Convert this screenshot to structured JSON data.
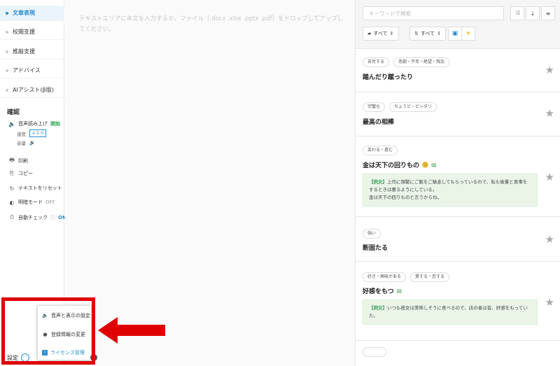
{
  "sidebar": {
    "items": [
      {
        "label": "文章表現",
        "active": true
      },
      {
        "label": "校閲支援"
      },
      {
        "label": "推敲支援"
      },
      {
        "label": "アドバイス"
      },
      {
        "label": "AIアシスト(β版)"
      }
    ],
    "confirm_title": "確認",
    "tts_label": "音声読み上げ",
    "tts_start": "開始",
    "speed_label": "速度",
    "speed_value": "x 1.0",
    "volume_label": "音量",
    "print_label": "印刷",
    "copy_label": "コピー",
    "reset_label": "テキストをリセット",
    "light_mode_label": "明暗モード",
    "light_mode_value": "OFF",
    "auto_check_label": "自動チェック",
    "auto_check_value": "ON",
    "settings_label": "設定"
  },
  "editor": {
    "placeholder": "テキストエリアに本文を入力するか、ファイル（.docx .xlsx .pptx .pdf）をドロップしてアップしてください。"
  },
  "right": {
    "search_placeholder": "キーワードで検索",
    "filter1": "すべて",
    "filter2": "すべて",
    "cards": [
      {
        "tags": [
          "苦労する",
          "悲劇・不幸・絶望・残念"
        ],
        "word": "踏んだり蹴ったり"
      },
      {
        "tags": [
          "完璧な",
          "ちょうど・ピッタリ"
        ],
        "word": "最高の相棒"
      },
      {
        "tags": [
          "変わる・進む"
        ],
        "word": "金は天下の回りもの",
        "example_label": "【例文】",
        "example": "上司に頻繁にご飯をご馳走してもらっているので、私も後輩と食事をするときは奢るようにしている。",
        "example2": "金は天下の回りものと言うからね。"
      },
      {
        "tags": [
          "強い"
        ],
        "word": "断固たる"
      },
      {
        "tags": [
          "好き・興味がある",
          "愛する・恋する"
        ],
        "word": "好感をもつ",
        "example_label": "【例文】",
        "example": "いつも彼女は美味しそうに食べるので、店の者は皆、好感をもっていた。"
      }
    ]
  },
  "popup": {
    "items": [
      {
        "label": "音声と表示の設定"
      },
      {
        "label": "登録情報の変更"
      },
      {
        "label": "ライセンス管理",
        "active": true
      }
    ]
  },
  "colors": {
    "accent": "#2a8fd0",
    "highlight": "#e00000",
    "green": "#2fa84f"
  }
}
